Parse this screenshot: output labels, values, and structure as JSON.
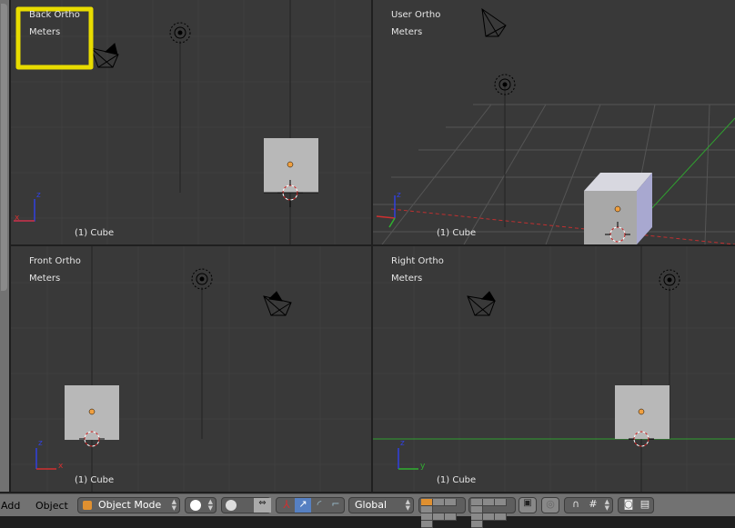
{
  "viewports": [
    {
      "view": "Back Ortho",
      "units": "Meters",
      "object": "(1) Cube"
    },
    {
      "view": "User Ortho",
      "units": "Meters",
      "object": "(1) Cube"
    },
    {
      "view": "Front Ortho",
      "units": "Meters",
      "object": "(1) Cube"
    },
    {
      "view": "Right Ortho",
      "units": "Meters",
      "object": "(1) Cube"
    }
  ],
  "header": {
    "menus": [
      "Add",
      "Object"
    ],
    "mode": "Object Mode",
    "orientation": "Global"
  },
  "colors": {
    "highlight": "#e8dc00",
    "x_axis": "#d03030",
    "y_axis": "#30b030",
    "z_axis": "#3040e0",
    "cube": "#b8b8b8",
    "viewport_bg": "#393939"
  }
}
